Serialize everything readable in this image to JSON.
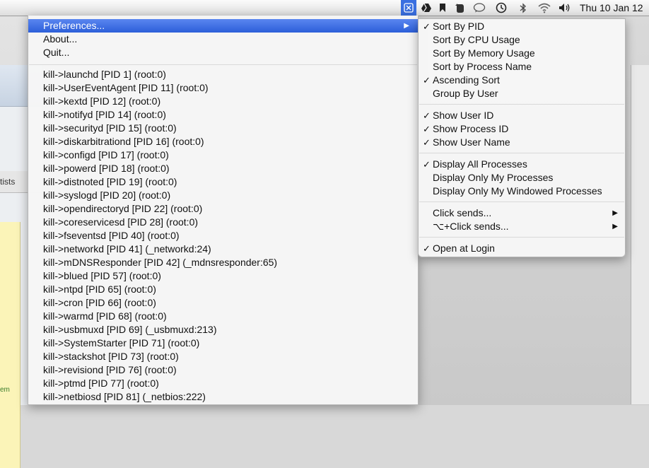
{
  "menubar": {
    "clock": "Thu 10 Jan  12",
    "icons": [
      "processkiller-icon",
      "google-drive-icon",
      "bookmark-icon",
      "evernote-icon",
      "chat-bubble-icon",
      "time-machine-icon",
      "bluetooth-icon",
      "wifi-icon",
      "volume-icon"
    ]
  },
  "background": {
    "tab_label": "tists",
    "note_text": "em"
  },
  "menu": {
    "top_items": [
      {
        "label": "Preferences...",
        "highlighted": true,
        "submenu": true
      },
      {
        "label": "About..."
      },
      {
        "label": "Quit..."
      }
    ],
    "processes": [
      "kill->launchd [PID 1]  (root:0)",
      "kill->UserEventAgent [PID 11]  (root:0)",
      "kill->kextd [PID 12]  (root:0)",
      "kill->notifyd [PID 14]  (root:0)",
      "kill->securityd [PID 15]  (root:0)",
      "kill->diskarbitrationd [PID 16]  (root:0)",
      "kill->configd [PID 17]  (root:0)",
      "kill->powerd [PID 18]  (root:0)",
      "kill->distnoted [PID 19]  (root:0)",
      "kill->syslogd [PID 20]  (root:0)",
      "kill->opendirectoryd [PID 22]  (root:0)",
      "kill->coreservicesd [PID 28]  (root:0)",
      "kill->fseventsd [PID 40]  (root:0)",
      "kill->networkd [PID 41]  (_networkd:24)",
      "kill->mDNSResponder [PID 42]  (_mdnsresponder:65)",
      "kill->blued [PID 57]  (root:0)",
      "kill->ntpd [PID 65]  (root:0)",
      "kill->cron [PID 66]  (root:0)",
      "kill->warmd [PID 68]  (root:0)",
      "kill->usbmuxd [PID 69]  (_usbmuxd:213)",
      "kill->SystemStarter [PID 71]  (root:0)",
      "kill->stackshot [PID 73]  (root:0)",
      "kill->revisiond [PID 76]  (root:0)",
      "kill->ptmd [PID 77]  (root:0)",
      "kill->netbiosd [PID 81]  (_netbios:222)"
    ]
  },
  "submenu": {
    "groups": [
      [
        {
          "label": "Sort By PID",
          "checked": true
        },
        {
          "label": "Sort By CPU Usage",
          "checked": false
        },
        {
          "label": "Sort By Memory Usage",
          "checked": false
        },
        {
          "label": "Sort by Process Name",
          "checked": false
        },
        {
          "label": "Ascending Sort",
          "checked": true
        },
        {
          "label": "Group By User",
          "checked": false
        }
      ],
      [
        {
          "label": "Show User ID",
          "checked": true
        },
        {
          "label": "Show Process ID",
          "checked": true
        },
        {
          "label": "Show User Name",
          "checked": true
        }
      ],
      [
        {
          "label": "Display All Processes",
          "checked": true
        },
        {
          "label": "Display Only My Processes",
          "checked": false
        },
        {
          "label": "Display Only My Windowed Processes",
          "checked": false
        }
      ],
      [
        {
          "label": "Click sends...",
          "checked": false,
          "submenu": true
        },
        {
          "label": "⌥+Click sends...",
          "checked": false,
          "submenu": true
        }
      ],
      [
        {
          "label": "Open at Login",
          "checked": true
        }
      ]
    ]
  },
  "colors": {
    "highlight": "#3a6fe0",
    "menu_bg": "#f6f6f6"
  }
}
